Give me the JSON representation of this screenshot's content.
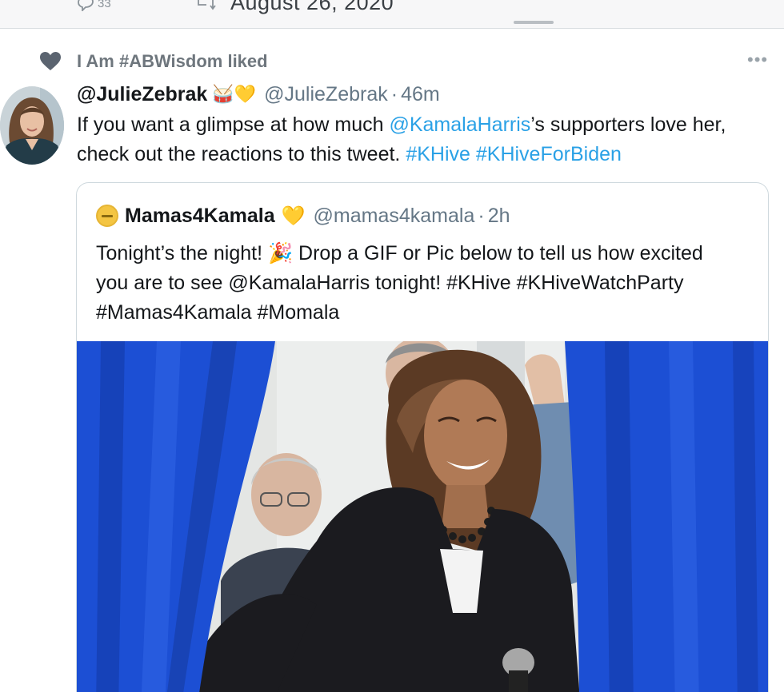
{
  "previous_tweet": {
    "reply_count": "33",
    "reply_icon": "reply-icon",
    "retweet_icon": "retweet-icon",
    "date": "August 26, 2020"
  },
  "social_context": {
    "icon": "heart-icon",
    "text": "I Am #ABWisdom liked"
  },
  "more_menu": "•••",
  "tweet": {
    "display_name": "@JulieZebrak",
    "emojis": "🥁💛",
    "handle": "@JulieZebrak",
    "separator": "·",
    "time": "46m",
    "text_1": "If you want a glimpse at how much ",
    "mention": "@KamalaHarris",
    "text_2": "’s supporters love her, check out the reactions to this tweet. ",
    "hashtag_1": "#KHive",
    "space": " ",
    "hashtag_2": "#KHiveForBiden"
  },
  "quote": {
    "display_name": "Mamas4Kamala",
    "heart": "💛",
    "handle": "@mamas4kamala",
    "separator": "·",
    "time": "2h",
    "text": "Tonight’s the night! 🎉 Drop a GIF or Pic below to tell us how excited you are to see @KamalaHarris tonight! #KHive #KHiveWatchParty #Mamas4Kamala #Momala",
    "media_icon": "photo-image"
  },
  "colors": {
    "link": "#2aa1e6",
    "secondary": "#657786",
    "curtain": "#1a4fd0"
  }
}
